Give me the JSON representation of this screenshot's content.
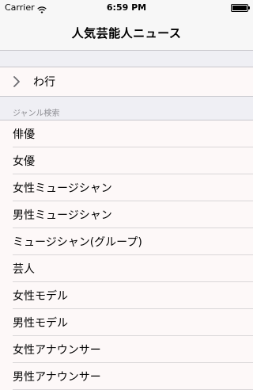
{
  "status_bar": {
    "carrier": "Carrier",
    "time": "6:59 PM",
    "battery_level": 1.0
  },
  "nav": {
    "title": "人気芸能人ニュース"
  },
  "top_row": {
    "label": "わ行",
    "icon": "chevron-right-icon"
  },
  "genre_section": {
    "header": "ジャンル検索",
    "items": [
      "俳優",
      "女優",
      "女性ミュージシャン",
      "男性ミュージシャン",
      "ミュージシャン(グループ)",
      "芸人",
      "女性モデル",
      "男性モデル",
      "女性アナウンサー",
      "男性アナウンサー"
    ]
  },
  "colors": {
    "row_background": "#fdf8f8",
    "group_background": "#efeff4",
    "section_header_text": "#8e8e93"
  }
}
